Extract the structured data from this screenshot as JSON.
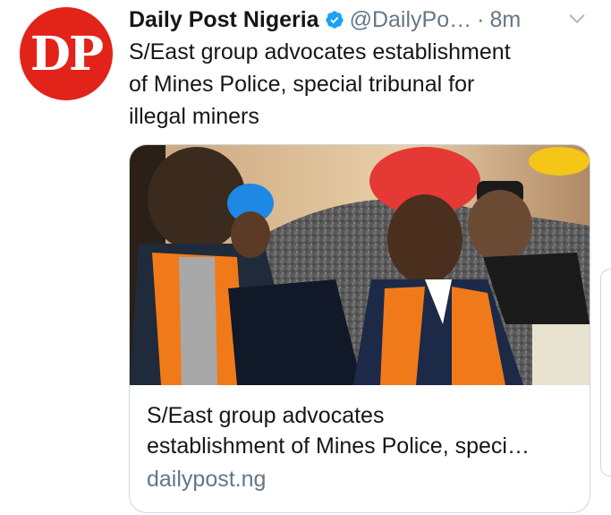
{
  "tweet": {
    "avatar_text": "DP",
    "author_name": "Daily Post Nigeria",
    "handle": "@DailyPo…",
    "separator": "·",
    "time": "8m",
    "verified_icon": "verified-badge-icon",
    "menu_icon": "chevron-down-icon",
    "text_lines": [
      "S/East group advocates establishment",
      "of Mines Police, special tribunal for",
      "illegal miners"
    ],
    "card": {
      "image": "mine-site-photo",
      "title_lines": [
        "S/East group advocates",
        "establishment of Mines Police, speci…"
      ],
      "domain": "dailypost.ng"
    }
  },
  "colors": {
    "avatar_red": "#e2231a",
    "verified_blue": "#1da1f2",
    "secondary_text": "#657786",
    "border": "#ccd6dd"
  }
}
